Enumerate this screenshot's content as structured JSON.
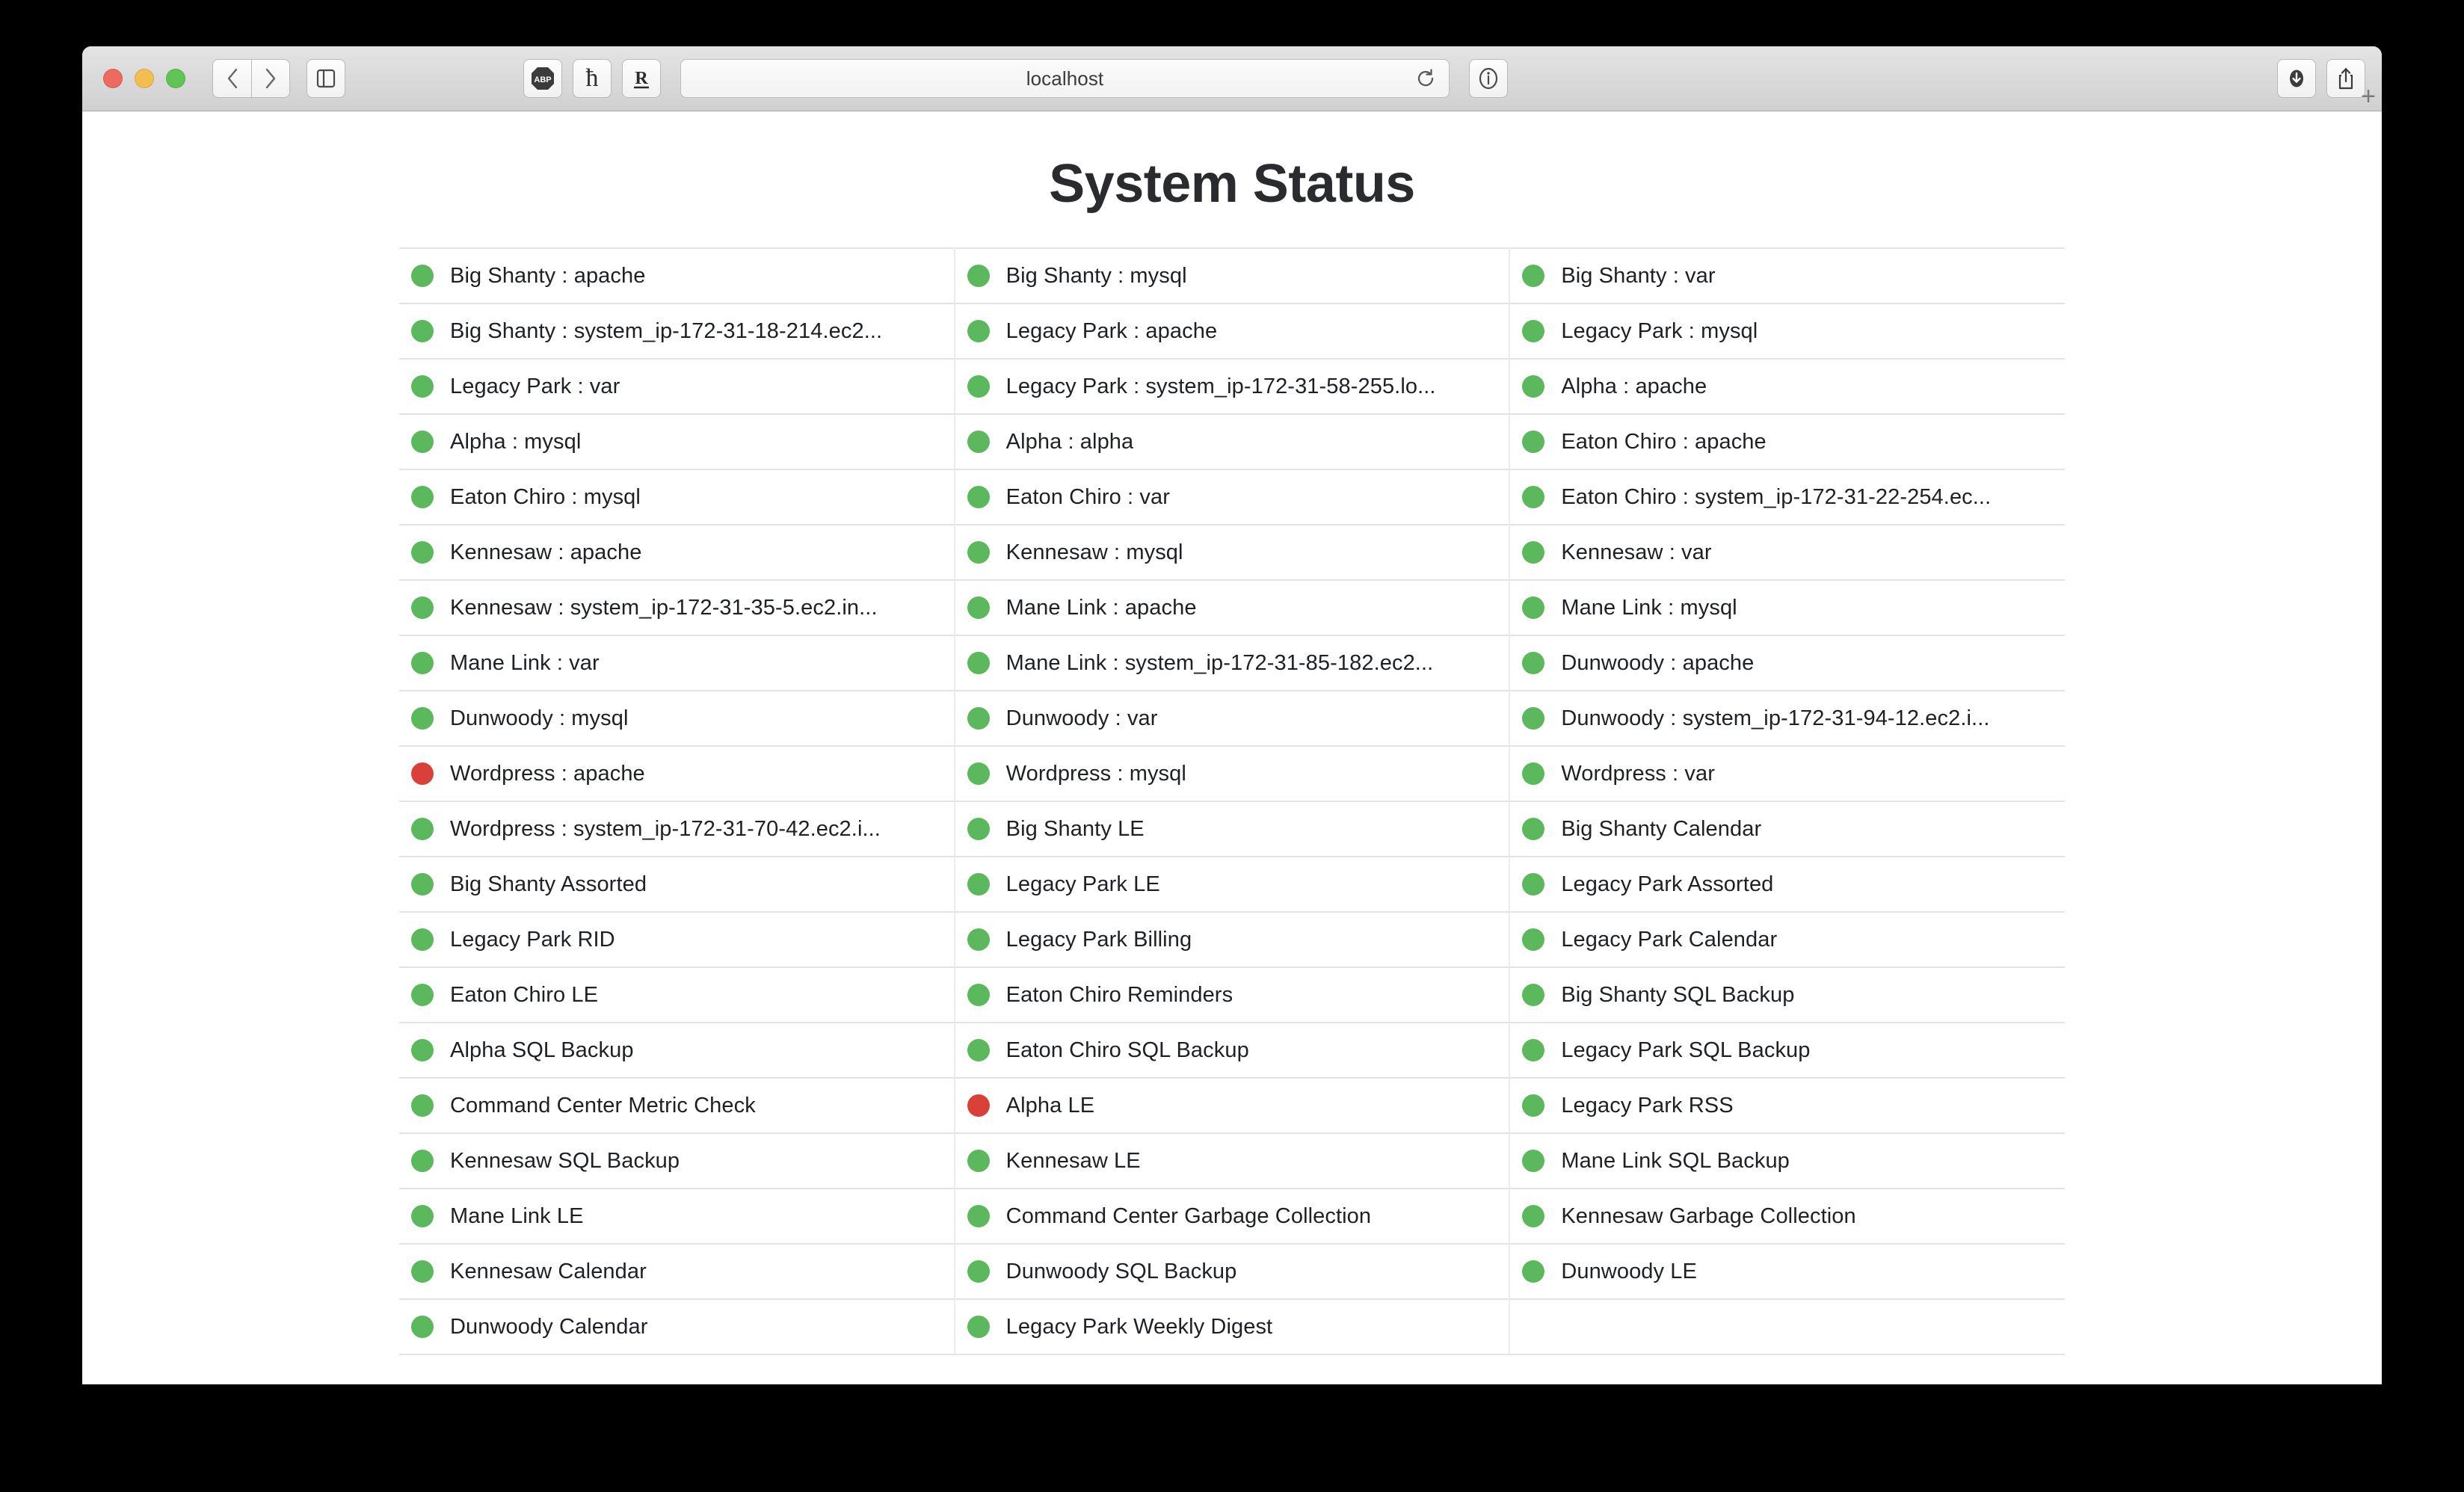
{
  "browser": {
    "address_value": "localhost",
    "traffic_lights": [
      "close",
      "minimize",
      "maximize"
    ],
    "toolbar": {
      "back_label": "‹",
      "forward_label": "›",
      "sidebar_icon": "sidebar-icon",
      "extensions": [
        {
          "name": "adblock-plus-extension",
          "label": "ABP"
        },
        {
          "name": "honey-extension",
          "label": "ℏ"
        },
        {
          "name": "reader-extension",
          "label": "R"
        }
      ],
      "reload_icon": "reload-icon",
      "info_icon": "info-icon",
      "downloads_icon": "downloads-icon",
      "share_icon": "share-icon",
      "new_tab_label": "+"
    }
  },
  "page": {
    "title": "System Status",
    "colors": {
      "up": "#5cb85c",
      "down": "#d9403a"
    },
    "rows": [
      [
        {
          "status": "up",
          "label": "Big Shanty : apache"
        },
        {
          "status": "up",
          "label": "Big Shanty : mysql"
        },
        {
          "status": "up",
          "label": "Big Shanty : var"
        }
      ],
      [
        {
          "status": "up",
          "label": "Big Shanty : system_ip-172-31-18-214.ec2..."
        },
        {
          "status": "up",
          "label": "Legacy Park : apache"
        },
        {
          "status": "up",
          "label": "Legacy Park : mysql"
        }
      ],
      [
        {
          "status": "up",
          "label": "Legacy Park : var"
        },
        {
          "status": "up",
          "label": "Legacy Park : system_ip-172-31-58-255.lo..."
        },
        {
          "status": "up",
          "label": "Alpha : apache"
        }
      ],
      [
        {
          "status": "up",
          "label": "Alpha : mysql"
        },
        {
          "status": "up",
          "label": "Alpha : alpha"
        },
        {
          "status": "up",
          "label": "Eaton Chiro : apache"
        }
      ],
      [
        {
          "status": "up",
          "label": "Eaton Chiro : mysql"
        },
        {
          "status": "up",
          "label": "Eaton Chiro : var"
        },
        {
          "status": "up",
          "label": "Eaton Chiro : system_ip-172-31-22-254.ec..."
        }
      ],
      [
        {
          "status": "up",
          "label": "Kennesaw : apache"
        },
        {
          "status": "up",
          "label": "Kennesaw : mysql"
        },
        {
          "status": "up",
          "label": "Kennesaw : var"
        }
      ],
      [
        {
          "status": "up",
          "label": "Kennesaw : system_ip-172-31-35-5.ec2.in..."
        },
        {
          "status": "up",
          "label": "Mane Link : apache"
        },
        {
          "status": "up",
          "label": "Mane Link : mysql"
        }
      ],
      [
        {
          "status": "up",
          "label": "Mane Link : var"
        },
        {
          "status": "up",
          "label": "Mane Link : system_ip-172-31-85-182.ec2..."
        },
        {
          "status": "up",
          "label": "Dunwoody : apache"
        }
      ],
      [
        {
          "status": "up",
          "label": "Dunwoody : mysql"
        },
        {
          "status": "up",
          "label": "Dunwoody : var"
        },
        {
          "status": "up",
          "label": "Dunwoody : system_ip-172-31-94-12.ec2.i..."
        }
      ],
      [
        {
          "status": "down",
          "label": "Wordpress : apache"
        },
        {
          "status": "up",
          "label": "Wordpress : mysql"
        },
        {
          "status": "up",
          "label": "Wordpress : var"
        }
      ],
      [
        {
          "status": "up",
          "label": "Wordpress : system_ip-172-31-70-42.ec2.i..."
        },
        {
          "status": "up",
          "label": "Big Shanty LE"
        },
        {
          "status": "up",
          "label": "Big Shanty Calendar"
        }
      ],
      [
        {
          "status": "up",
          "label": "Big Shanty Assorted"
        },
        {
          "status": "up",
          "label": "Legacy Park LE"
        },
        {
          "status": "up",
          "label": "Legacy Park Assorted"
        }
      ],
      [
        {
          "status": "up",
          "label": "Legacy Park RID"
        },
        {
          "status": "up",
          "label": "Legacy Park Billing"
        },
        {
          "status": "up",
          "label": "Legacy Park Calendar"
        }
      ],
      [
        {
          "status": "up",
          "label": "Eaton Chiro LE"
        },
        {
          "status": "up",
          "label": "Eaton Chiro Reminders"
        },
        {
          "status": "up",
          "label": "Big Shanty SQL Backup"
        }
      ],
      [
        {
          "status": "up",
          "label": "Alpha SQL Backup"
        },
        {
          "status": "up",
          "label": "Eaton Chiro SQL Backup"
        },
        {
          "status": "up",
          "label": "Legacy Park SQL Backup"
        }
      ],
      [
        {
          "status": "up",
          "label": "Command Center Metric Check"
        },
        {
          "status": "down",
          "label": "Alpha LE"
        },
        {
          "status": "up",
          "label": "Legacy Park RSS"
        }
      ],
      [
        {
          "status": "up",
          "label": "Kennesaw SQL Backup"
        },
        {
          "status": "up",
          "label": "Kennesaw LE"
        },
        {
          "status": "up",
          "label": "Mane Link SQL Backup"
        }
      ],
      [
        {
          "status": "up",
          "label": "Mane Link LE"
        },
        {
          "status": "up",
          "label": "Command Center Garbage Collection"
        },
        {
          "status": "up",
          "label": "Kennesaw Garbage Collection"
        }
      ],
      [
        {
          "status": "up",
          "label": "Kennesaw Calendar"
        },
        {
          "status": "up",
          "label": "Dunwoody SQL Backup"
        },
        {
          "status": "up",
          "label": "Dunwoody LE"
        }
      ],
      [
        {
          "status": "up",
          "label": "Dunwoody Calendar"
        },
        {
          "status": "up",
          "label": "Legacy Park Weekly Digest"
        },
        {
          "status": "",
          "label": ""
        }
      ]
    ]
  }
}
